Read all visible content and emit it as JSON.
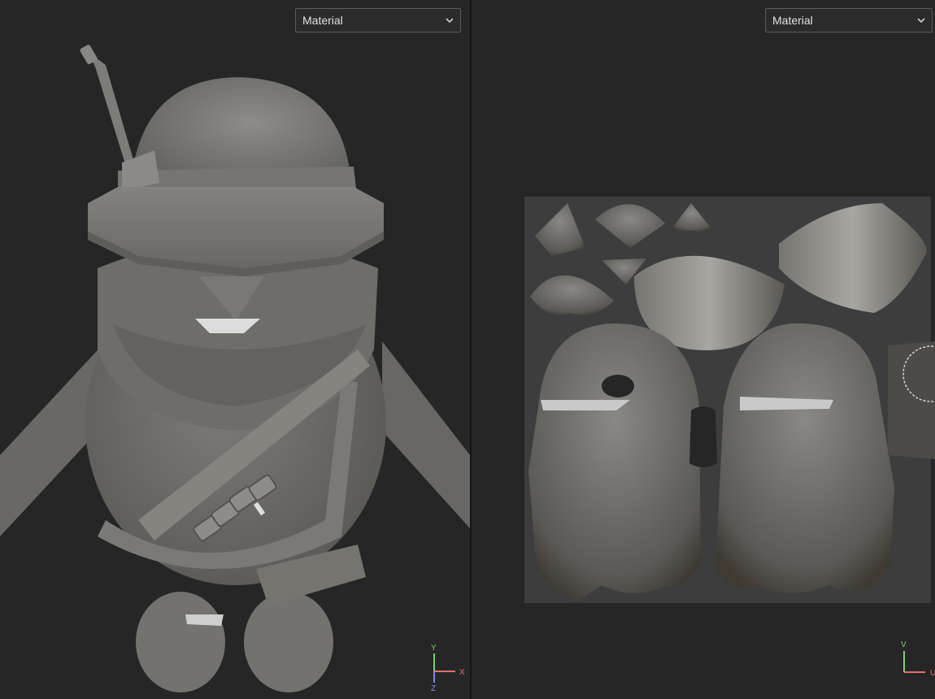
{
  "viewport_3d": {
    "shading_mode": "Material",
    "axis_labels": {
      "x": "X",
      "y": "Y",
      "z": "Z"
    },
    "colors": {
      "x": "#e0706f",
      "y": "#7fcf6f",
      "z": "#7f87e6"
    }
  },
  "viewport_uv": {
    "shading_mode": "Material",
    "axis_labels": {
      "u": "U",
      "v": "V"
    },
    "colors": {
      "u": "#e0706f",
      "v": "#7fcf6f"
    }
  },
  "icons": [
    "chevron-down-icon",
    "axis-gizmo-icon"
  ]
}
